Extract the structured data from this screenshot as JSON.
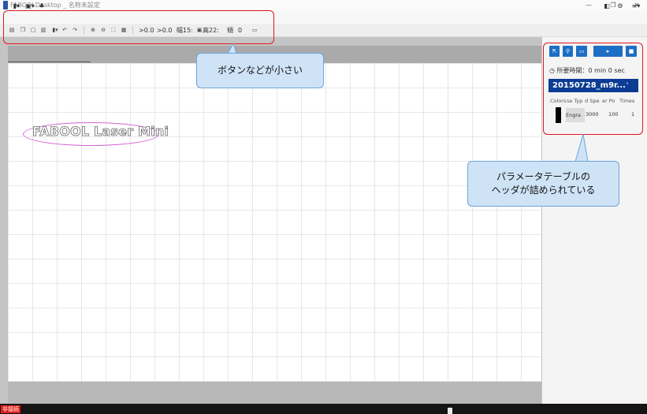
{
  "window": {
    "title": "FABOOLDesktop _ 名称未設定",
    "minimize_glyph": "—",
    "maximize_glyph": "❐",
    "close_glyph": "✕"
  },
  "menubar": {
    "file_glyph": "▮▾",
    "save_glyph": "▣▾",
    "share_glyph": "♣",
    "view_glyph": "◧",
    "settings_glyph": "⚙",
    "menu_glyph": "≡▾"
  },
  "toolbar": {
    "icons": {
      "new": "▤",
      "copy": "❐",
      "paste": "▢",
      "duplicate": "▥",
      "align": "▮▾",
      "undo": "↶",
      "redo": "↷",
      "zoom_in": "⊕",
      "zoom_out": "⊖",
      "fit": "⛶",
      "grid": "▦",
      "lock": "▣",
      "image": "▭"
    },
    "x_field": ">0.0",
    "y_field": ">0.0",
    "width_field": "幅15:",
    "height_field": "高22:",
    "angle_label": "傾",
    "angle_field": "0"
  },
  "canvas": {
    "text": "FABOOL Laser Mini"
  },
  "panel": {
    "buttons": {
      "select_glyph": "⇱",
      "pin_glyph": "⚲",
      "frame_glyph": "▭",
      "start_glyph": "▸",
      "stop_glyph": "■"
    },
    "time_label": "◷ 所要時間：0 min 0 sec",
    "layer_name": "20150728_m9r...",
    "layer_chevron": "˄",
    "columns": [
      "Colors",
      "se Typ",
      "d Spe",
      "er Po",
      "Times"
    ],
    "row": {
      "color": "#000000",
      "type": "Engra",
      "speed": "3000",
      "power": "100",
      "times": "1"
    }
  },
  "callouts": {
    "toolbar_note": "ボタンなどが小さい",
    "table_note_line1": "パラメータテーブルの",
    "table_note_line2": "ヘッダが詰められている"
  },
  "status": {
    "connection": "非接続"
  },
  "colors": {
    "accent": "#1d6ec5",
    "layer_header": "#0b3c94",
    "annotation_red": "#e0161d",
    "callout_fill": "#cfe3f7",
    "ellipse": "#d462d4"
  }
}
